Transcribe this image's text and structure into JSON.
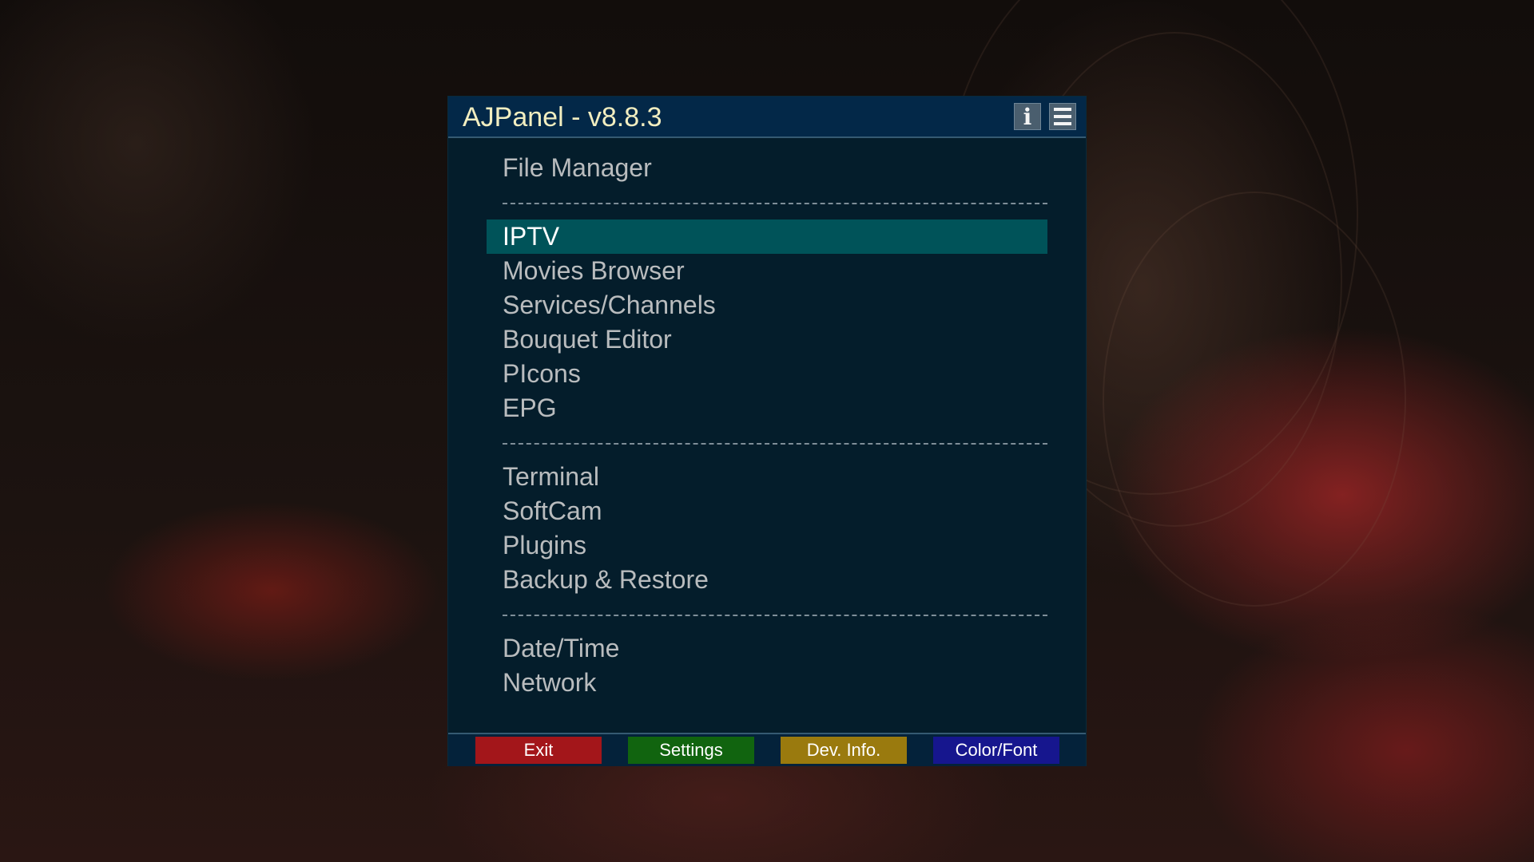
{
  "window": {
    "title": "AJPanel - v8.8.3",
    "info_glyph": "i",
    "info_icon": "info-icon",
    "menu_icon": "hamburger-menu-icon"
  },
  "menu": {
    "items": [
      {
        "type": "item",
        "label": "File Manager"
      },
      {
        "type": "separator"
      },
      {
        "type": "item",
        "label": "IPTV",
        "selected": true
      },
      {
        "type": "item",
        "label": "Movies Browser"
      },
      {
        "type": "item",
        "label": "Services/Channels"
      },
      {
        "type": "item",
        "label": "Bouquet Editor"
      },
      {
        "type": "item",
        "label": "PIcons"
      },
      {
        "type": "item",
        "label": "EPG"
      },
      {
        "type": "separator"
      },
      {
        "type": "item",
        "label": "Terminal"
      },
      {
        "type": "item",
        "label": "SoftCam"
      },
      {
        "type": "item",
        "label": "Plugins"
      },
      {
        "type": "item",
        "label": "Backup & Restore"
      },
      {
        "type": "separator"
      },
      {
        "type": "item",
        "label": "Date/Time"
      },
      {
        "type": "item",
        "label": "Network"
      }
    ],
    "selected_color": "#005359"
  },
  "footer": {
    "red_label": "Exit",
    "green_label": "Settings",
    "yellow_label": "Dev. Info.",
    "blue_label": "Color/Font",
    "colors": {
      "red": "#a3161a",
      "green": "#11640f",
      "yellow": "#9a7a0e",
      "blue": "#16168e"
    }
  }
}
